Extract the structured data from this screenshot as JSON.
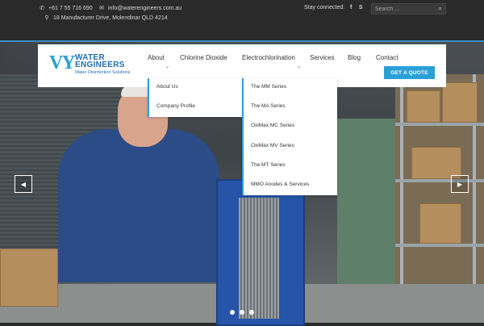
{
  "topbar": {
    "phone": "+61 7 55 716 690",
    "email": "info@waterengineers.com.au",
    "address": "18 Manufacturer Drive, Molendinar QLD 4214",
    "stay_connected": "Stay connected:",
    "search_placeholder": "Search ..."
  },
  "logo": {
    "mark": "VY",
    "line1": "WATER",
    "line2": "ENGINEERS",
    "tagline": "Water Disinfection Solutions"
  },
  "nav": {
    "items": [
      "About",
      "Chlorine Dioxide",
      "Electrochlorination",
      "Services",
      "Blog",
      "Contact"
    ],
    "cta": "GET A QUOTE"
  },
  "dropdown_about": [
    "About Us",
    "Company Profile"
  ],
  "dropdown_electro": [
    "The MM Series",
    "The MA Series",
    "OxiMax MC Series",
    "OxiMax MV Series",
    "The MT Series",
    "MMO Anodes & Services"
  ],
  "hero": {
    "prev_icon": "chevron-left-icon",
    "next_icon": "chevron-right-icon",
    "slides": 3
  },
  "colors": {
    "accent": "#2aa0d8",
    "topbar_bg": "#2a2a2a",
    "brand": "#1f6db3"
  }
}
